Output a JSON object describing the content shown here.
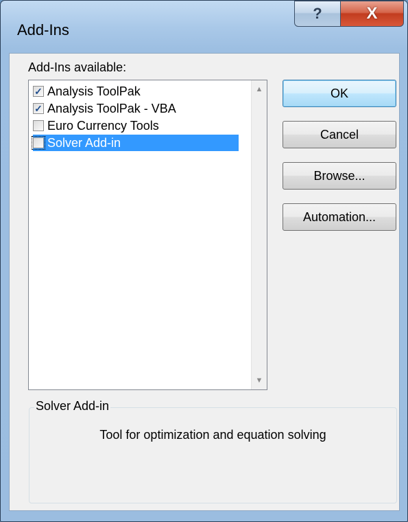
{
  "window": {
    "title": "Add-Ins",
    "help_glyph": "?",
    "close_glyph": "X"
  },
  "addins": {
    "label": "Add-Ins available:",
    "items": [
      {
        "label": "Analysis ToolPak",
        "checked": true,
        "selected": false
      },
      {
        "label": "Analysis ToolPak - VBA",
        "checked": true,
        "selected": false
      },
      {
        "label": "Euro Currency Tools",
        "checked": false,
        "selected": false
      },
      {
        "label": "Solver Add-in",
        "checked": false,
        "selected": true
      }
    ]
  },
  "buttons": {
    "ok": "OK",
    "cancel": "Cancel",
    "browse": "Browse...",
    "automation": "Automation..."
  },
  "description": {
    "title": "Solver Add-in",
    "text": "Tool for optimization and equation solving"
  },
  "colors": {
    "selection": "#3399ff",
    "close_button": "#c23c1f",
    "default_button_border": "#3c7fb1"
  },
  "icons": {
    "help": "help-icon",
    "close": "close-icon",
    "check": "check-icon",
    "scroll_up": "scroll-up-icon",
    "scroll_down": "scroll-down-icon"
  }
}
